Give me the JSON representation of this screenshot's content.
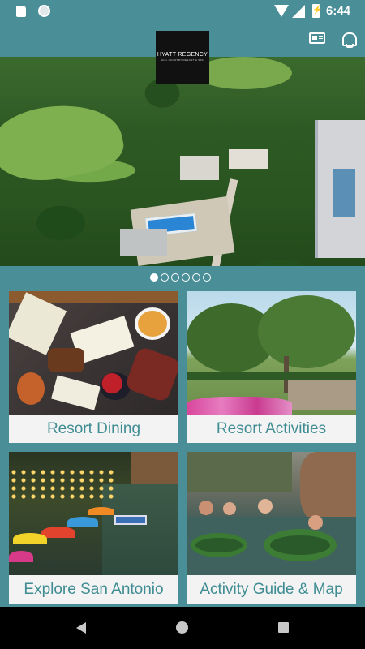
{
  "status_bar": {
    "time": "6:44",
    "icons": [
      "sd-card-icon",
      "circle-icon",
      "wifi-icon",
      "signal-icon",
      "battery-charging-icon"
    ]
  },
  "header": {
    "logo_text": "HYATT REGENCY",
    "logo_subtext": "HILL COUNTRY RESORT & SPA",
    "icons": [
      "news-icon",
      "bell-icon"
    ]
  },
  "hero": {
    "image": "aerial-resort-photo",
    "pages": 6,
    "active_page": 1
  },
  "tiles": [
    {
      "label": "Resort Dining",
      "image": "charcuterie-board-photo"
    },
    {
      "label": "Resort Activities",
      "image": "garden-trees-photo"
    },
    {
      "label": "Explore San Antonio",
      "image": "river-walk-photo"
    },
    {
      "label": "Activity Guide & Map",
      "image": "lazy-river-tubing-photo"
    }
  ],
  "nav_bar": {
    "icons": [
      "back-icon",
      "home-icon",
      "recent-apps-icon"
    ]
  },
  "colors": {
    "primary": "#4a8f97",
    "tile_label_text": "#3f8d93",
    "tile_label_bg": "#f3f3f3"
  }
}
